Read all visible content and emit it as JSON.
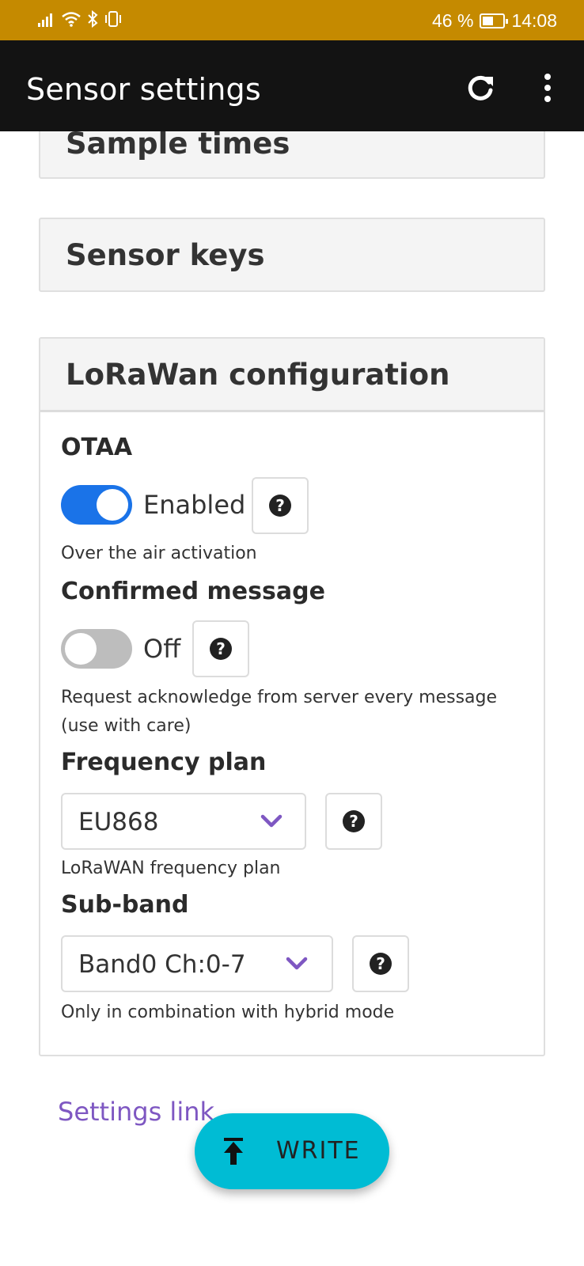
{
  "status_bar": {
    "battery_percent": "46 %",
    "time": "14:08"
  },
  "app_bar": {
    "title": "Sensor settings",
    "refresh_icon": "refresh-icon",
    "more_icon": "more-vert-icon"
  },
  "panels": {
    "sample_times": "Sample times",
    "sensor_keys": "Sensor keys",
    "lorawan": "LoRaWan configuration"
  },
  "otaa": {
    "label": "OTAA",
    "enabled": true,
    "state_label": "Enabled",
    "hint": "Over the air activation"
  },
  "confirmed": {
    "label": "Confirmed message",
    "enabled": false,
    "state_label": "Off",
    "hint_line1": "Request acknowledge from server every message",
    "hint_line2": "(use with care)"
  },
  "frequency_plan": {
    "label": "Frequency plan",
    "value": "EU868",
    "hint": "LoRaWAN frequency plan"
  },
  "sub_band": {
    "label": "Sub-band",
    "value": "Band0 Ch:0-7",
    "hint": "Only in combination with hybrid mode"
  },
  "help_glyph": "?",
  "settings_link": "Settings link",
  "fab": {
    "label": "WRITE",
    "icon": "upload-icon"
  },
  "colors": {
    "status_bar": "#c58a00",
    "app_bar": "#131313",
    "toggle_on": "#1a73e8",
    "chevron": "#7e57c2",
    "link": "#7e57c2",
    "fab": "#00bcd4"
  }
}
